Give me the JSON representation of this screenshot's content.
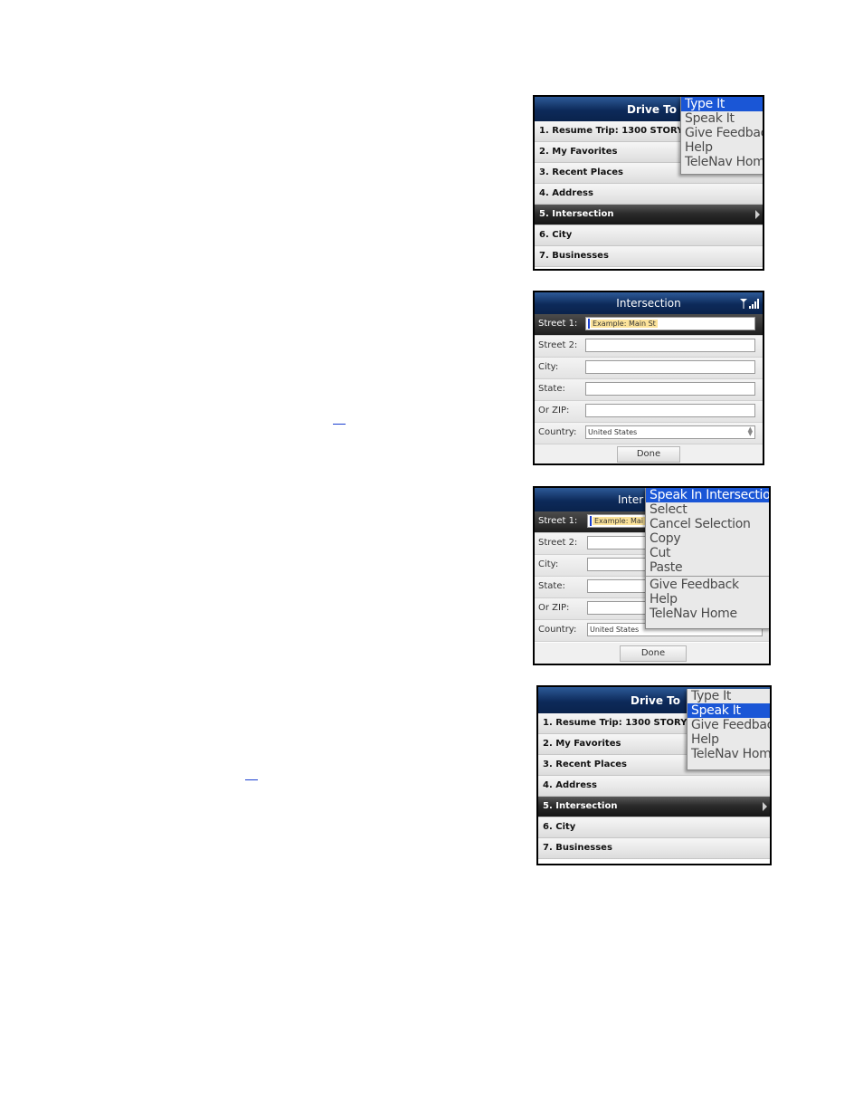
{
  "drive_to": {
    "title": "Drive To",
    "items": [
      "1. Resume Trip: 1300 STORY",
      "2. My Favorites",
      "3. Recent Places",
      "4. Address",
      "5. Intersection",
      "6. City",
      "7. Businesses"
    ],
    "selected_index": 4
  },
  "menu_type_it": {
    "items": [
      "Type It",
      "Speak It",
      "Give Feedback",
      "Help",
      "TeleNav Home"
    ],
    "highlighted": "Type It"
  },
  "menu_speak_it": {
    "items": [
      "Type It",
      "Speak It",
      "Give Feedback",
      "Help",
      "TeleNav Home"
    ],
    "highlighted": "Speak It"
  },
  "intersection": {
    "title": "Intersection",
    "title_partial": "Inter",
    "street1_label": "Street 1:",
    "street1_placeholder": "Example: Main St",
    "street1_placeholder_partial": "Example: Mai",
    "street2_label": "Street 2:",
    "city_label": "City:",
    "state_label": "State:",
    "zip_label": "Or ZIP:",
    "country_label": "Country:",
    "country_value": "United States",
    "done_label": "Done"
  },
  "context_menu": {
    "items": [
      "Speak In Intersection",
      "Select",
      "Cancel Selection",
      "Copy",
      "Cut",
      "Paste",
      "Give Feedback",
      "Help",
      "TeleNav Home"
    ],
    "highlighted": "Speak In Intersection"
  },
  "colors": {
    "header_blue": "#0d2a5a",
    "highlight_blue": "#1a56d6",
    "placeholder_yellow": "#fce39a"
  }
}
